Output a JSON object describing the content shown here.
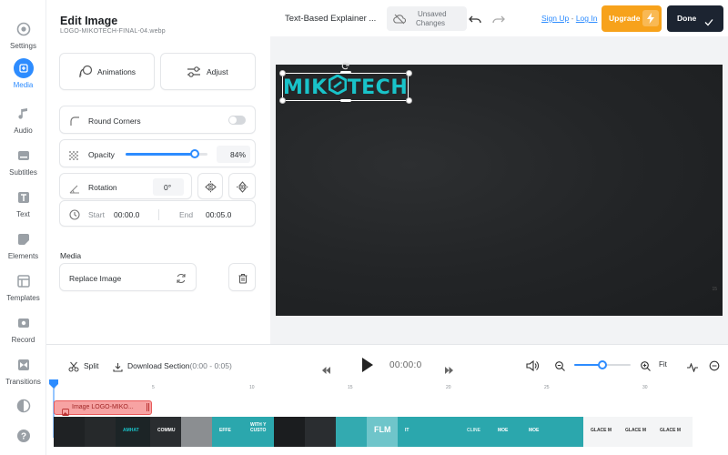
{
  "rail": [
    {
      "label": "Settings",
      "icon": "settings-icon"
    },
    {
      "label": "Media",
      "icon": "plus-icon",
      "active": true
    },
    {
      "label": "Audio",
      "icon": "music-note-icon"
    },
    {
      "label": "Subtitles",
      "icon": "subtitles-icon"
    },
    {
      "label": "Text",
      "icon": "text-icon"
    },
    {
      "label": "Elements",
      "icon": "elements-icon"
    },
    {
      "label": "Templates",
      "icon": "templates-icon"
    },
    {
      "label": "Record",
      "icon": "record-icon"
    },
    {
      "label": "Transitions",
      "icon": "transitions-icon"
    }
  ],
  "panel": {
    "title": "Edit Image",
    "filename": "LOGO-MIKOTECH-FINAL-04.webp",
    "animations_label": "Animations",
    "adjust_label": "Adjust",
    "round_corners_label": "Round Corners",
    "opacity_label": "Opacity",
    "opacity_value": "84%",
    "opacity_fraction": 0.84,
    "rotation_label": "Rotation",
    "rotation_value": "0°",
    "start_label": "Start",
    "start_value": "00:00.0",
    "end_label": "End",
    "end_value": "00:05.0",
    "media_heading": "Media",
    "replace_label": "Replace Image"
  },
  "topbar": {
    "project_title": "Text-Based Explainer ...",
    "unsaved_line1": "Unsaved",
    "unsaved_line2": "Changes",
    "sign_up": "Sign Up",
    "separator": " - ",
    "log_in": "Log In",
    "upgrade_label": "Upgrade",
    "done_label": "Done"
  },
  "canvas": {
    "logo_text_left": "MIK",
    "logo_text_right": "TECH",
    "corner_mark": "15"
  },
  "timeline": {
    "split_label": "Split",
    "download_label": "Download Section",
    "download_range": "(0:00 - 0:05)",
    "time_display": "00:00:0",
    "fit_label": "Fit",
    "zoom_fraction": 0.5,
    "ruler": [
      "0",
      "5",
      "10",
      "15",
      "20",
      "25",
      "30"
    ],
    "clip_label": "Image LOGO-MIKO...",
    "thumbs": [
      "",
      "",
      "AMHAT",
      "COMMU",
      "",
      "EFFE",
      "WITH Y CUSTO",
      "",
      "",
      "",
      "FLM",
      "IT",
      "",
      "CLINE",
      "MOE",
      "MOE",
      "",
      "GLACE M",
      "GLACE M",
      "GLACE M"
    ]
  },
  "colors": {
    "accent": "#2d8cff",
    "upgrade": "#f7a21b",
    "done": "#1c2431",
    "logo_teal": "#19c3c9",
    "clip_red": "#e85a5a"
  }
}
